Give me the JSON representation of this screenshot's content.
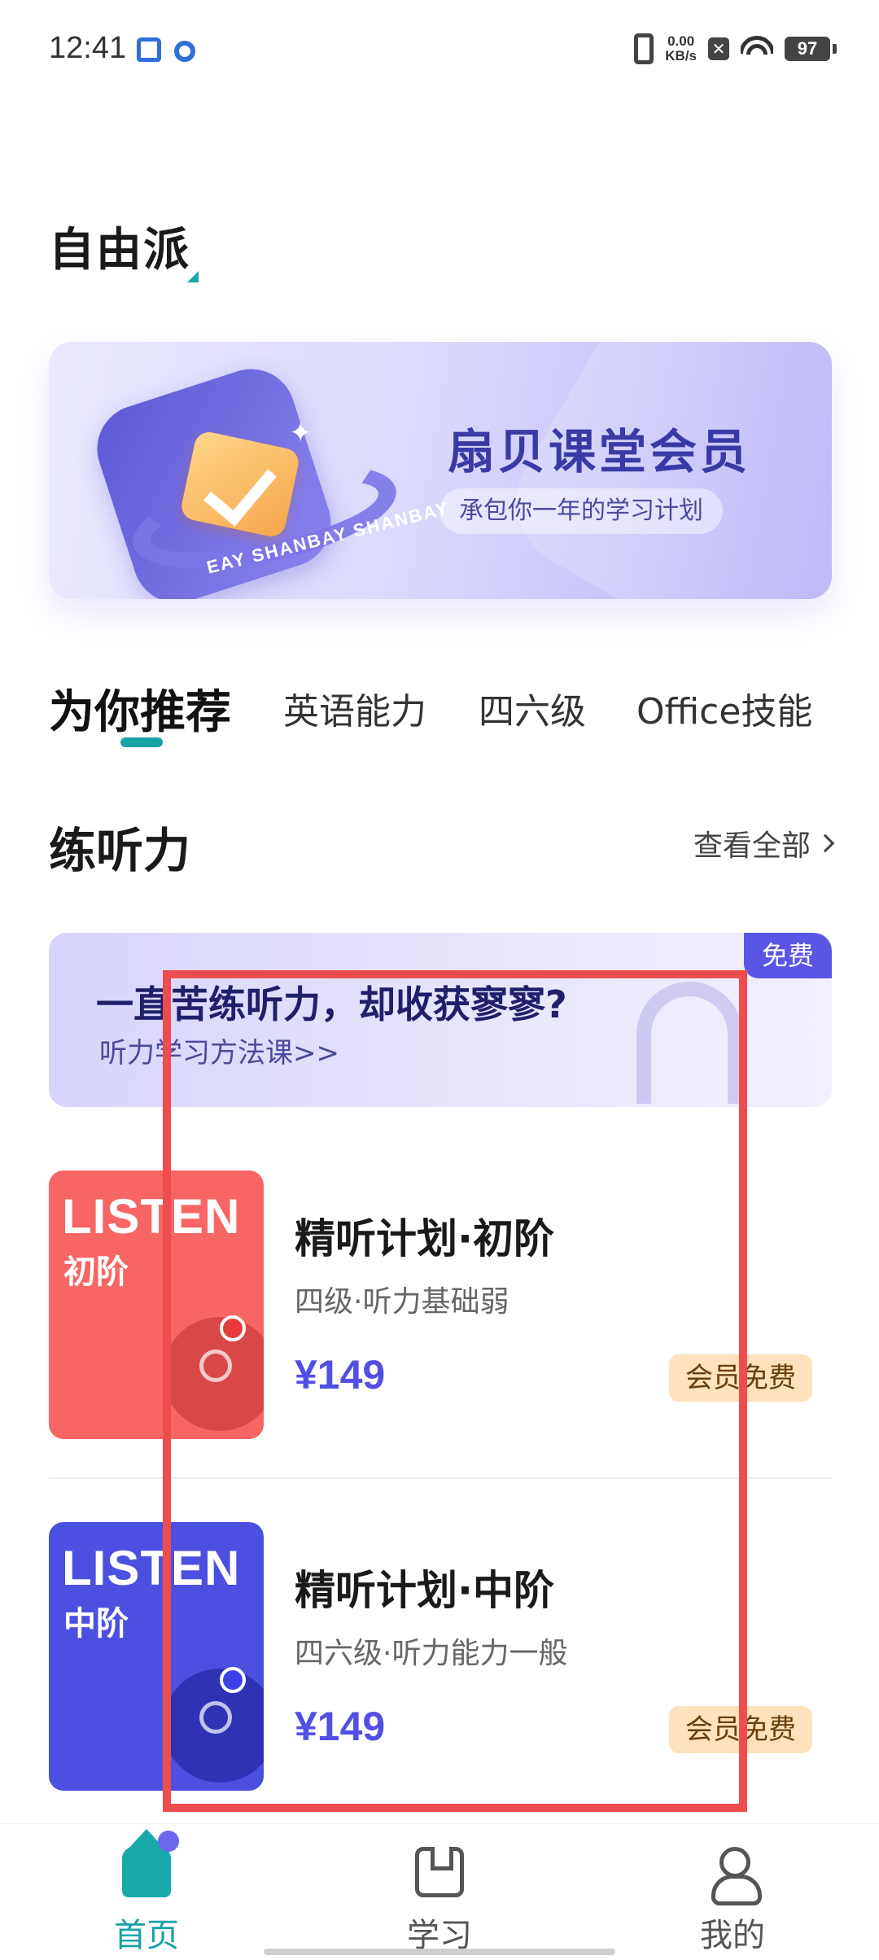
{
  "status_bar": {
    "time": "12:41",
    "net_speed_value": "0.00",
    "net_speed_unit": "KB/s",
    "battery": "97"
  },
  "header": {
    "brand": "自由派"
  },
  "member_banner": {
    "title": "扇贝课堂会员",
    "subtitle": "承包你一年的学习计划",
    "ring_text": "EAY SHANBAY SHANBAY"
  },
  "tabs": [
    {
      "label": "为你推荐",
      "active": true
    },
    {
      "label": "英语能力",
      "active": false
    },
    {
      "label": "四六级",
      "active": false
    },
    {
      "label": "Office技能",
      "active": false
    }
  ],
  "section": {
    "title": "练听力",
    "see_all": "查看全部"
  },
  "free_banner": {
    "title": "一直苦练听力，却收获寥寥?",
    "subtitle": "听力学习方法课>>",
    "tag": "免费"
  },
  "courses": [
    {
      "thumb_text": "LISTEN",
      "thumb_level": "初阶",
      "title": "精听计划·初阶",
      "subtitle": "四级·听力基础弱",
      "price": "¥149",
      "badge": "会员免费",
      "color": "#f76565"
    },
    {
      "thumb_text": "LISTEN",
      "thumb_level": "中阶",
      "title": "精听计划·中阶",
      "subtitle": "四六级·听力能力一般",
      "price": "¥149",
      "badge": "会员免费",
      "color": "#4b50e0"
    }
  ],
  "bottom_nav": [
    {
      "label": "首页",
      "icon": "home-icon",
      "active": true
    },
    {
      "label": "学习",
      "icon": "notebook-icon",
      "active": false
    },
    {
      "label": "我的",
      "icon": "user-icon",
      "active": false
    }
  ],
  "colors": {
    "accent": "#17a2a6",
    "price": "#5250e4",
    "highlight": "#ef4d4d"
  }
}
